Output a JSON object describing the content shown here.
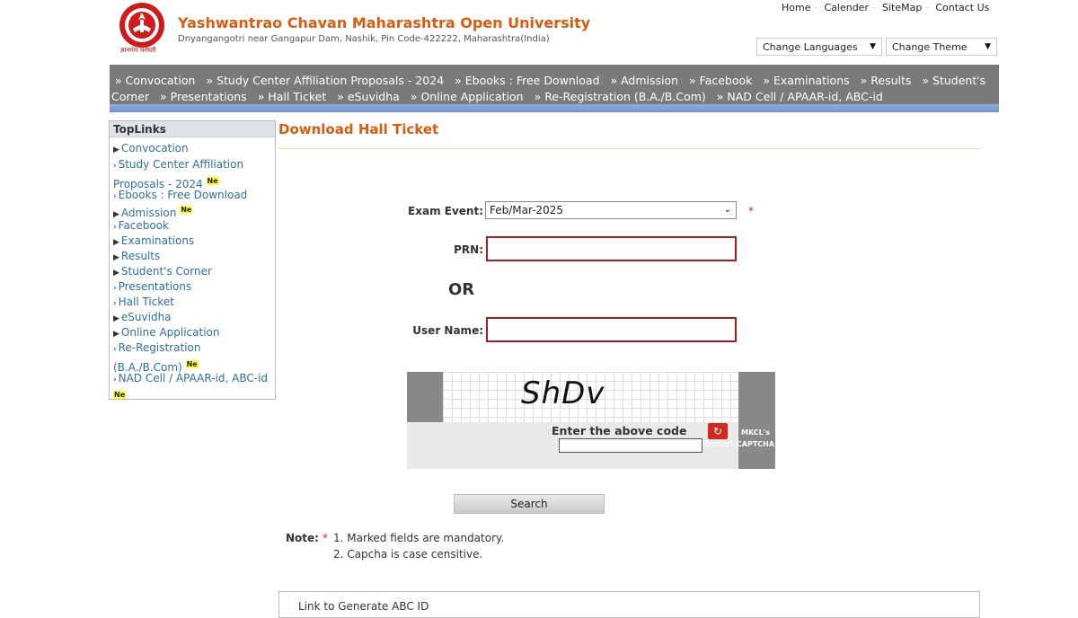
{
  "header": {
    "university_name": "Yashwantrao Chavan Maharashtra Open University",
    "address": "Dnyangangotri near Gangapur Dam, Nashik, Pin Code-422222, Maharashtra(India)",
    "logo_icon": "ycmou-logo-icon",
    "logo_caption": "ज्ञानगंगा घरोघरी",
    "top_links": [
      "Home",
      "Calender",
      "SiteMap",
      "Contact Us"
    ],
    "change_languages": "Change Languages",
    "change_theme": "Change Theme"
  },
  "nav": {
    "line1": [
      "Convocation",
      "Study Center Affiliation Proposals - 2024",
      "Ebooks : Free Download",
      "Admission",
      "Facebook",
      "Examinations",
      "Results",
      "Student's"
    ],
    "line2_start": "Corner",
    "line2": [
      "Presentations",
      "Hall Ticket",
      "eSuvidha",
      "Online Application",
      "Re-Registration (B.A./B.Com)",
      "NAD Cell / APAAR-id, ABC-id"
    ]
  },
  "sidebar": {
    "title": "TopLinks",
    "items": [
      {
        "label": "Convocation",
        "new": ""
      },
      {
        "label": "Study Center Affiliation Proposals - 2024",
        "new": "Ne"
      },
      {
        "label": "Ebooks : Free Download",
        "new": ""
      },
      {
        "label": "Admission",
        "new": "Ne"
      },
      {
        "label": "Facebook",
        "new": ""
      },
      {
        "label": "Examinations",
        "new": ""
      },
      {
        "label": "Results",
        "new": ""
      },
      {
        "label": "Student's Corner",
        "new": ""
      },
      {
        "label": "Presentations",
        "new": ""
      },
      {
        "label": "Hall Ticket",
        "new": ""
      },
      {
        "label": "eSuvidha",
        "new": ""
      },
      {
        "label": "Online Application",
        "new": ""
      },
      {
        "label": "Re-Registration (B.A./B.Com)",
        "new": "Ne"
      },
      {
        "label": "NAD Cell / APAAR-id, ABC-id",
        "new": "Ne"
      }
    ]
  },
  "main": {
    "heading": "Download Hall Ticket",
    "exam_event_label": "Exam Event:",
    "exam_event_value": "Feb/Mar-2025",
    "required_mark": "*",
    "prn_label": "PRN:",
    "prn_value": "",
    "or_text": "OR",
    "username_label": "User Name:",
    "username_value": ""
  },
  "captcha": {
    "code": "ShDv",
    "prompt": "Enter the above code",
    "value": "",
    "reload_label": "Reload",
    "reload_icon": "refresh-icon",
    "brand_line1": "MKCL's",
    "brand_line2": "CAPTCHA"
  },
  "search_label": "Search",
  "notes": {
    "label": "Note:",
    "star": "*",
    "items": [
      "1. Marked fields are mandatory.",
      "2. Capcha is case censitive."
    ]
  },
  "abc_link": "Link to Generate ABC ID",
  "colors": {
    "brand_orange": "#e05a0c",
    "nav_gray": "#7a7a7a",
    "link_blue": "#2a6fb0",
    "input_border_red": "#b01a1a",
    "new_badge_yellow": "#ffff33"
  }
}
